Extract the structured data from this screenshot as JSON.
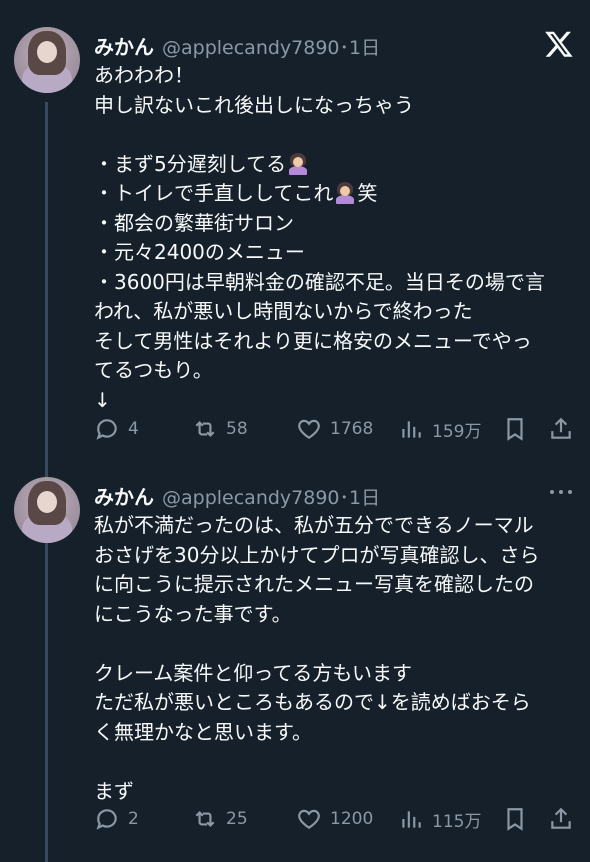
{
  "tweets": [
    {
      "name": "みかん",
      "handle_time": "@applecandy7890･1日",
      "corner_icon": "x-logo-icon",
      "lines": [
        "あわわわ！",
        "申し訳ないこれ後出しになっちゃう",
        "",
        "・まず5分遅刻してる",
        "・トイレで手直ししてこれ",
        "・都会の繁華街サロン",
        "・元々2400のメニュー",
        "・3600円は早朝料金の確認不足。当日その場で言",
        "われ、私が悪いし時間ないからで終わった",
        "そして男性はそれより更に格安のメニューでやっ",
        "てるつもり。",
        "↓"
      ],
      "line4_suffix": "笑",
      "actions": {
        "replies": "4",
        "retweets": "58",
        "likes": "1768",
        "views": "159万"
      }
    },
    {
      "name": "みかん",
      "handle_time": "@applecandy7890･1日",
      "corner_icon": "more-dots-icon",
      "lines": [
        "私が不満だったのは、私が五分でできるノーマル",
        "おさげを30分以上かけてプロが写真確認し、さら",
        "に向こうに提示されたメニュー写真を確認したの",
        "にこうなった事です。",
        "",
        "クレーム案件と仰ってる方もいます",
        "ただ私が悪いところもあるので↓を読めばおそら",
        "く無理かなと思います。",
        "",
        "まず"
      ],
      "actions": {
        "replies": "2",
        "retweets": "25",
        "likes": "1200",
        "views": "115万"
      }
    }
  ],
  "colors": {
    "background": "#15202b",
    "text": "#f7f9f9",
    "muted": "#8b98a5",
    "thread_line": "#3a4a5a"
  }
}
